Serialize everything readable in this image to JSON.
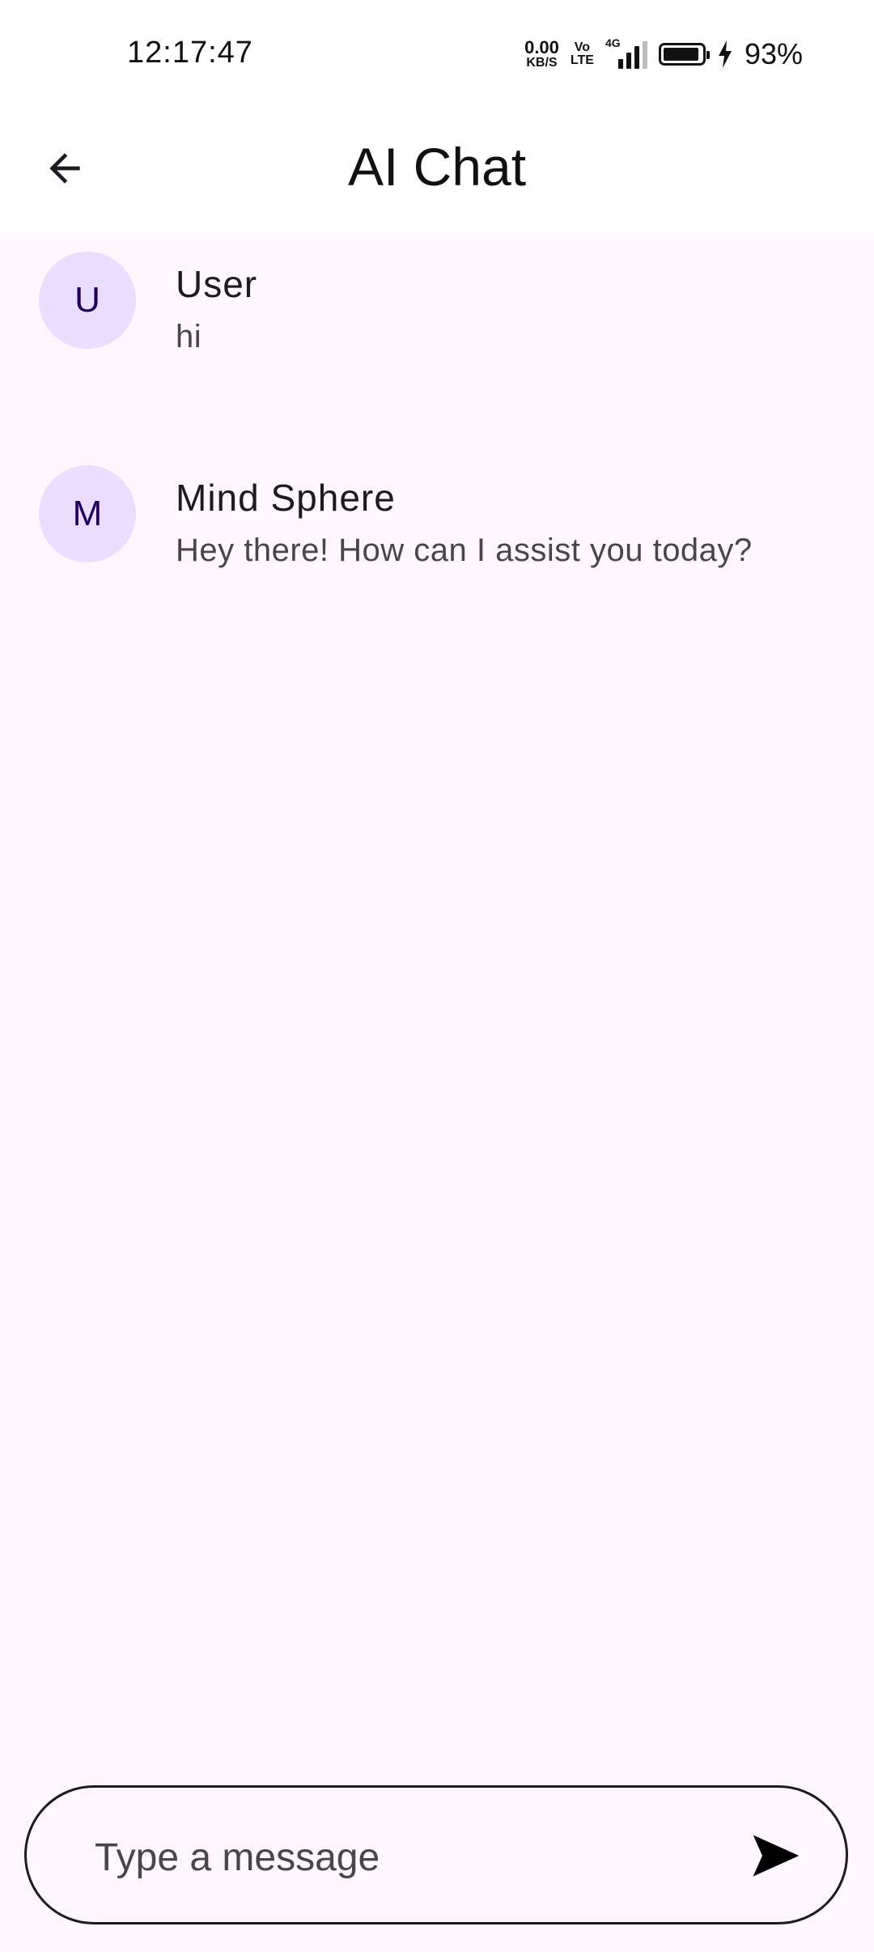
{
  "status_bar": {
    "time": "12:17:47",
    "net_speed_value": "0.00",
    "net_speed_unit": "KB/S",
    "volte_top": "Vo",
    "volte_bottom": "LTE",
    "network_type": "4G",
    "signal_level": 0.75,
    "battery_percent": "93%",
    "battery_level": 0.93,
    "charging": true
  },
  "app_bar": {
    "back_icon": "arrow-back-icon",
    "title": "AI Chat"
  },
  "messages": [
    {
      "avatar_letter": "U",
      "author": "User",
      "text": "hi"
    },
    {
      "avatar_letter": "M",
      "author": "Mind Sphere",
      "text": "Hey there! How can I assist you today?"
    }
  ],
  "composer": {
    "placeholder": "Type a message",
    "value": "",
    "send_icon": "send-icon"
  },
  "colors": {
    "background": "#fdf7fd",
    "avatar_bg": "#eaddff",
    "avatar_text": "#21005d",
    "outline": "#1c1b1f"
  }
}
